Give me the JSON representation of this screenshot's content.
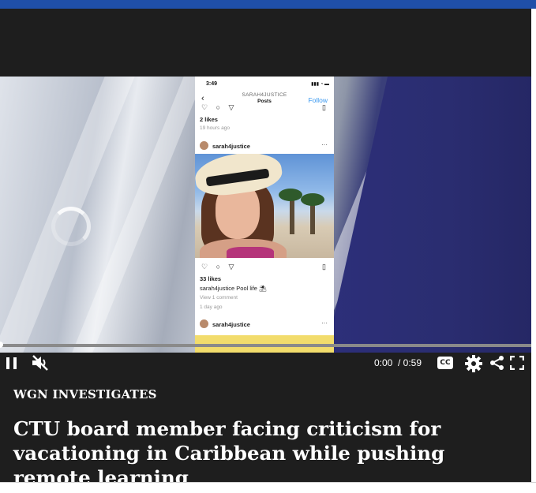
{
  "player": {
    "current_time": "0:00",
    "duration": "/ 0:59",
    "progress_fraction": 0.0,
    "state": "paused-indicator",
    "muted": true,
    "cc_label": "CC"
  },
  "instagram_post": {
    "clock": "3:49",
    "username_header": "SARAH4JUSTICE",
    "subheader": "Posts",
    "follow_label": "Follow",
    "prev_likes": "2 likes",
    "prev_time": "19 hours ago",
    "poster": "sarah4justice",
    "likes": "33 likes",
    "caption_user": "sarah4justice",
    "caption_text": "Pool life ⛱",
    "comments_link": "View 1 comment",
    "post_time": "1 day ago",
    "next_poster": "sarah4justice"
  },
  "article": {
    "kicker": "WGN INVESTIGATES",
    "headline": "CTU board member facing criticism for vacationing in Caribbean while pushing remote learning"
  },
  "colors": {
    "topbar": "#1f4fa8",
    "player_bg": "#1e1e1e",
    "link_blue": "#3897f0"
  }
}
